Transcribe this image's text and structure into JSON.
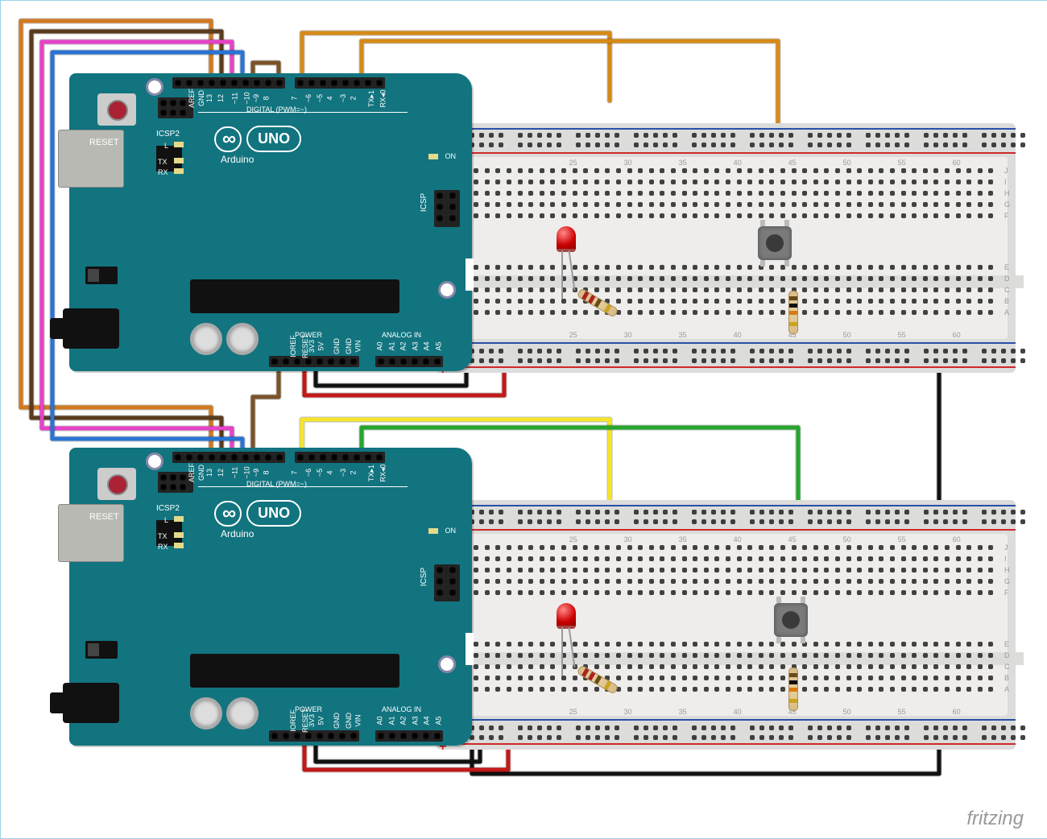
{
  "attribution": "fritzing",
  "arduino": {
    "reset": "RESET",
    "model": "Arduino",
    "brand_logo": "∞",
    "board_label": "UNO",
    "digital_header_label": "DIGITAL (PWM=~)",
    "power_label": "POWER",
    "analog_label": "ANALOG IN",
    "icsp2": "ICSP2",
    "icsp": "ICSP",
    "tx": "TX",
    "rx": "RX",
    "on": "ON",
    "l": "L",
    "top_pins": [
      "",
      "AREF",
      "GND",
      "13",
      "12",
      "~11",
      "~10",
      "~9",
      "8",
      "",
      "7",
      "~6",
      "~5",
      "4",
      "~3",
      "2",
      "TX▸1",
      "RX◂0"
    ],
    "power_pins": [
      "IOREF",
      "RESET",
      "3V3",
      "5V",
      "GND",
      "GND",
      "VIN"
    ],
    "analog_pins": [
      "A0",
      "A1",
      "A2",
      "A3",
      "A4",
      "A5"
    ]
  },
  "breadboard": {
    "columns": [
      25,
      30,
      35,
      40,
      45,
      50,
      55,
      60
    ],
    "rows_top": [
      "J",
      "I",
      "H",
      "G",
      "F"
    ],
    "rows_bottom": [
      "E",
      "D",
      "C",
      "B",
      "A"
    ],
    "plus": "+",
    "minus": "−"
  },
  "components": {
    "led1": "Red LED (top breadboard)",
    "led2": "Red LED (bottom breadboard)",
    "r1": "Resistor ~220Ω",
    "r2": "Resistor ~10kΩ",
    "btn1": "Tactile push button (top)",
    "btn2": "Tactile push button (bottom)"
  },
  "wires": {
    "spi_bus": "Orange/Brown/Magenta/Blue: SPI/signal lines between Arduino pins 10-13",
    "top_led_wire": "Orange jumper Arduino1 D7 → LED anode",
    "top_btn_wire": "Orange jumper Arduino1 D2 → pushbutton",
    "bot_led_wire": "Yellow jumper Arduino2 D7 → LED anode",
    "bot_btn_wire": "Green jumper Arduino2 D2 → pushbutton",
    "power_5v": "Red 5V → breadboard + rail",
    "power_gnd": "Black GND → breadboard − rail",
    "shared_gnd": "Black long wire: top breadboard GND → bottom breadboard GND"
  }
}
